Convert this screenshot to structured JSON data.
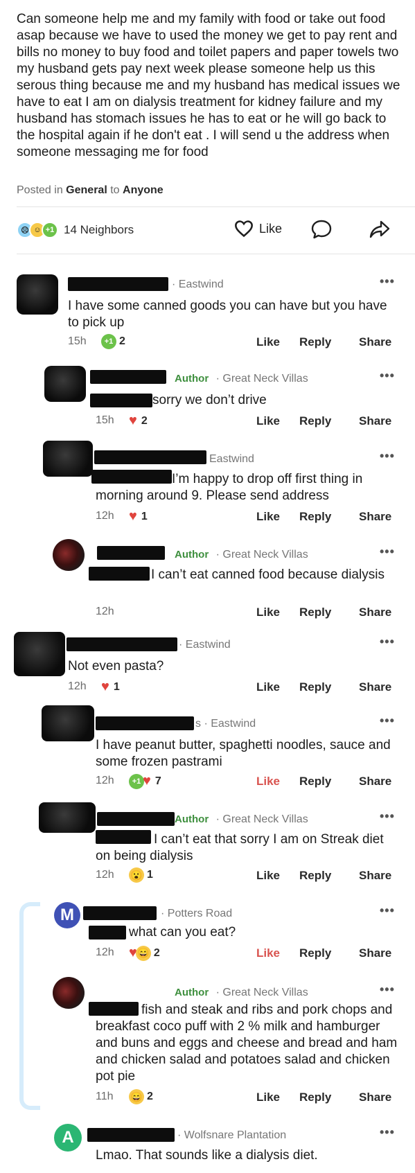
{
  "post": {
    "body": "Can someone help me and my family with food or take out food asap because we have to used the money we get to pay rent and bills no money to buy food and toilet papers and paper towels two my husband gets pay next week please someone help us this serous thing because me and my husband has medical issues we have to eat I am on dialysis treatment for kidney failure and my husband has stomach issues he has to eat or he will go back to the hospital again if he don't eat . I will send u the address when someone messaging me for food",
    "posted_prefix": "Posted in",
    "posted_category": "General",
    "posted_mid": "to",
    "posted_audience": "Anyone",
    "reaction_plus": "+1",
    "neighbors": "14 Neighbors",
    "like_label": "Like"
  },
  "actions": {
    "like": "Like",
    "reply": "Reply",
    "share": "Share",
    "more": "•••"
  },
  "comments": [
    {
      "location": "· Eastwind",
      "text": "I have some canned goods you can have but you have to pick up",
      "time": "15h",
      "count": "2",
      "reaction_plus": "+1"
    },
    {
      "author": "Author",
      "location": "· Great Neck Villas",
      "text": "sorry we don’t drive",
      "time": "15h",
      "count": "2"
    },
    {
      "location": "Eastwind",
      "text": "I’m happy to drop off first thing in morning around 9.  Please send address",
      "time": "12h",
      "count": "1"
    },
    {
      "author": "Author",
      "location": "· Great Neck Villas",
      "text": "I can’t eat canned food because dialysis",
      "time": "12h"
    },
    {
      "location": "· Eastwind",
      "text": "Not even pasta?",
      "time": "12h",
      "count": "1"
    },
    {
      "location": "s · Eastwind",
      "text": "I have peanut butter, spaghetti noodles, sauce and some frozen pastrami",
      "time": "12h",
      "count": "7",
      "reaction_plus": "+1"
    },
    {
      "author": "Author",
      "location": "· Great Neck Villas",
      "text": "I can’t eat that sorry I am on Streak diet on being dialysis",
      "time": "12h",
      "count": "1"
    },
    {
      "avatar_letter": "M",
      "location": "· Potters Road",
      "text": "what can you eat?",
      "time": "12h",
      "count": "2"
    },
    {
      "author": "Author",
      "location": "· Great Neck Villas",
      "text": "fish and steak and ribs and pork chops and breakfast coco puff with 2 % milk and hamburger and buns and eggs and cheese and bread and ham and chicken salad and potatoes salad and chicken pot pie",
      "time": "11h",
      "count": "2"
    },
    {
      "avatar_letter": "A",
      "location": "· Wolfsnare Plantation",
      "text": "Lmao. That sounds like a dialysis diet."
    }
  ],
  "colors": {
    "author_green": "#3e8f3e",
    "heart_red": "#e0443d",
    "thread_blue": "#d6ecfb",
    "avatar_m": "#3f51b5",
    "avatar_a": "#2bb673"
  },
  "icons": [
    "heart-outline-icon",
    "speech-bubble-icon",
    "share-arrow-icon",
    "more-icon",
    "heart-icon",
    "plus-one-icon",
    "wow-icon",
    "grin-icon",
    "sad-icon",
    "smile-icon"
  ]
}
